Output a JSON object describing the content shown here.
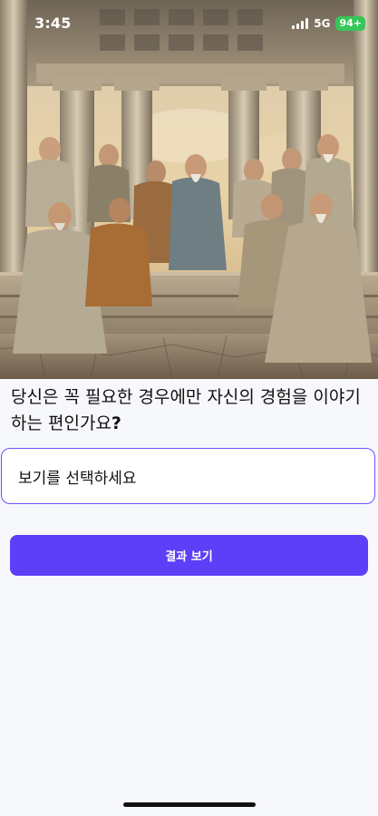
{
  "status_bar": {
    "time": "3:45",
    "network": "5G",
    "battery": "94+",
    "battery_color": "#36c759"
  },
  "hero": {
    "image": "painting of ancient philosophers seated in conversation beneath a columned portico"
  },
  "question": {
    "text": "당신은 꼭 필요한 경우에만 자신의 경험을 이야기하는 편인가요",
    "mark": "?"
  },
  "select": {
    "placeholder": "보기를 선택하세요",
    "border_color": "#6654ff"
  },
  "result_button": {
    "label": "결과 보기",
    "color": "#5d3ff7"
  },
  "icons": [
    "signal-icon",
    "battery-icon"
  ]
}
